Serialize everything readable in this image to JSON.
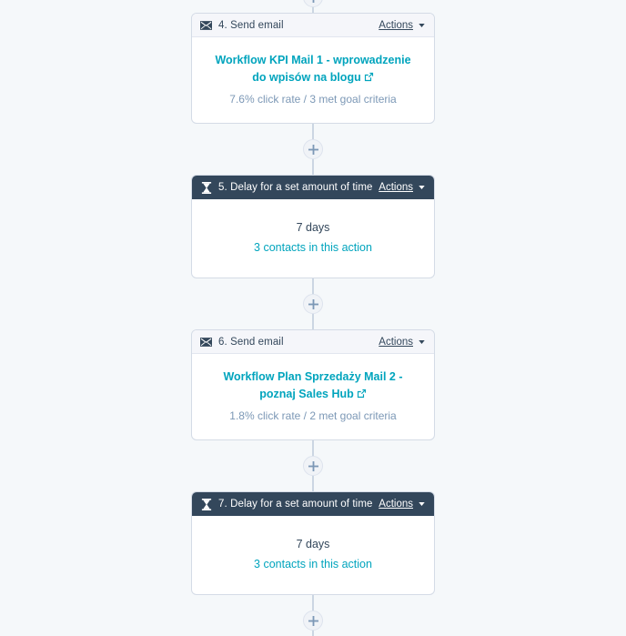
{
  "page": {
    "background_color": "#f5f8fa",
    "accent_link_color": "#00a4bd",
    "dark_header_color": "#33475b",
    "light_header_color": "#f5f6fa",
    "connector_color": "#cbd6e2"
  },
  "actions_menu": {
    "label": "Actions",
    "caret_icon": "chevron-down-icon"
  },
  "add_step_button": {
    "icon": "plus-icon",
    "label": "+"
  },
  "steps": [
    {
      "type": "email",
      "icon": "envelope-icon",
      "header": "4. Send email",
      "actions_label": "Actions",
      "email_name": "Workflow KPI Mail 1 - wprowadzenie do wpisów na blogu",
      "external_link_icon": "external-link-icon",
      "stats": "7.6% click rate / 3 met goal criteria"
    },
    {
      "type": "delay",
      "icon": "hourglass-icon",
      "header": "5. Delay for a set amount of time",
      "actions_label": "Actions",
      "duration": "7 days",
      "contacts": "3 contacts in this action"
    },
    {
      "type": "email",
      "icon": "envelope-icon",
      "header": "6. Send email",
      "actions_label": "Actions",
      "email_name": "Workflow Plan Sprzedaży Mail 2 - poznaj Sales Hub",
      "external_link_icon": "external-link-icon",
      "stats": "1.8% click rate / 2 met goal criteria"
    },
    {
      "type": "delay",
      "icon": "hourglass-icon",
      "header": "7. Delay for a set amount of time",
      "actions_label": "Actions",
      "duration": "7 days",
      "contacts": "3 contacts in this action"
    }
  ]
}
